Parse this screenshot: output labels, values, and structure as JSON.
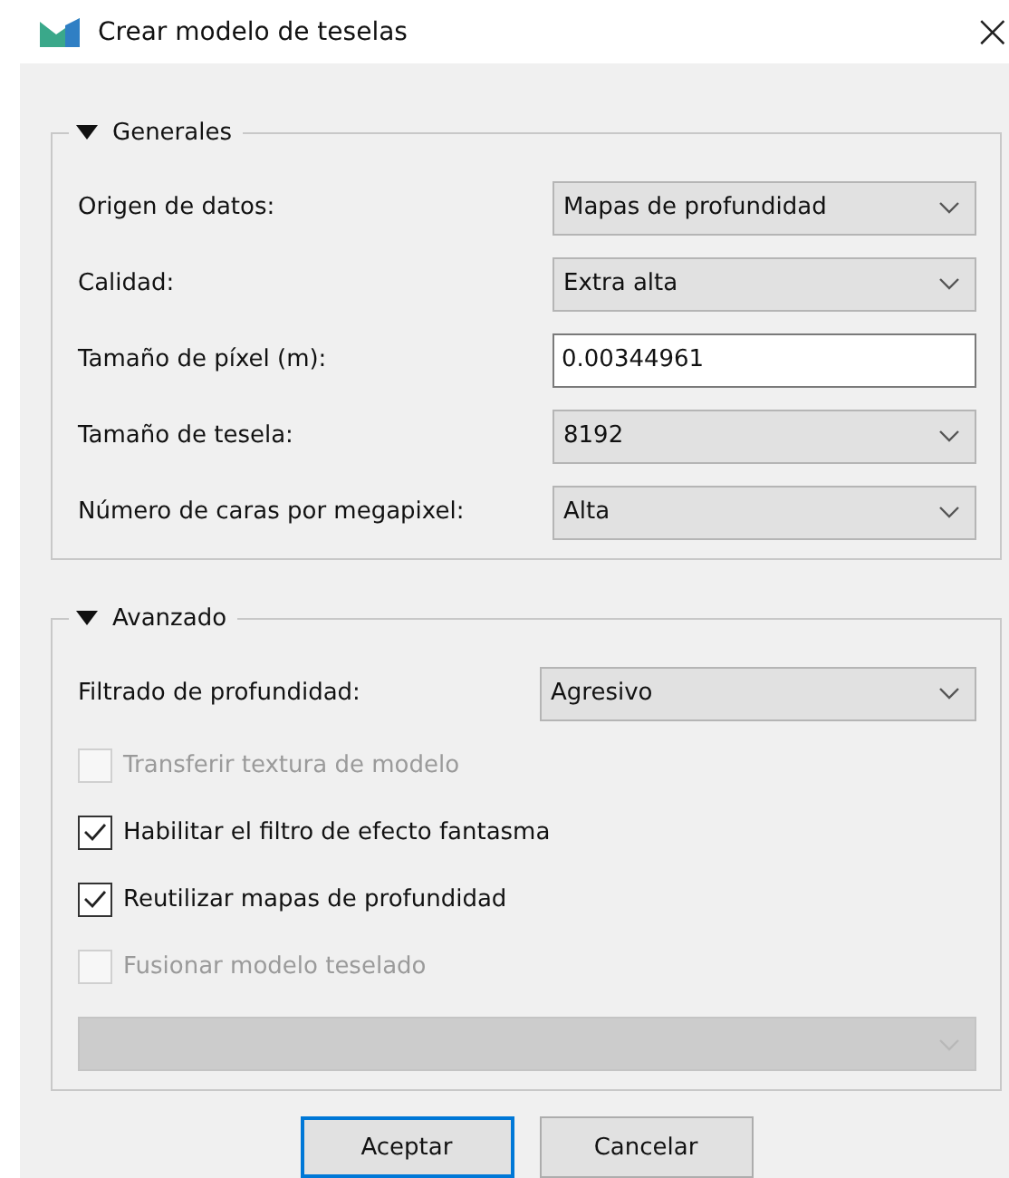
{
  "window": {
    "title": "Crear modelo de teselas",
    "close": "×"
  },
  "groups": [
    {
      "title": "Generales",
      "expanded": true,
      "items": [
        {
          "kind": "combo",
          "label": "Origen de datos:",
          "value": "Mapas de profundidad"
        },
        {
          "kind": "combo",
          "label": "Calidad:",
          "value": "Extra alta"
        },
        {
          "kind": "input",
          "label": "Tamaño de píxel (m):",
          "value": "0.00344961"
        },
        {
          "kind": "combo",
          "label": "Tamaño de tesela:",
          "value": "8192"
        },
        {
          "kind": "combo",
          "label": "Número de caras por megapixel:",
          "value": "Alta"
        }
      ]
    },
    {
      "title": "Avanzado",
      "expanded": true,
      "items": [
        {
          "kind": "combo",
          "label": "Filtrado de profundidad:",
          "value": "Agresivo"
        },
        {
          "kind": "check",
          "label": "Transferir textura de modelo",
          "checked": false,
          "disabled": true
        },
        {
          "kind": "check",
          "label": "Habilitar el filtro de efecto fantasma",
          "checked": true,
          "disabled": false
        },
        {
          "kind": "check",
          "label": "Reutilizar mapas de profundidad",
          "checked": true,
          "disabled": false
        },
        {
          "kind": "check",
          "label": "Fusionar modelo teselado",
          "checked": false,
          "disabled": true
        },
        {
          "kind": "wide-combo",
          "disabled": true
        }
      ]
    }
  ],
  "buttons": [
    {
      "label": "Aceptar",
      "default": true
    },
    {
      "label": "Cancelar",
      "default": false
    }
  ]
}
